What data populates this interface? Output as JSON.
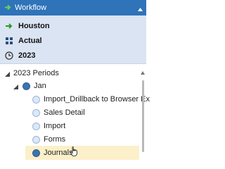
{
  "header": {
    "title": "Workflow"
  },
  "pov": [
    {
      "icon": "arrow-right-icon",
      "label": "Houston"
    },
    {
      "icon": "scenario-grid-icon",
      "label": "Actual"
    },
    {
      "icon": "clock-icon",
      "label": "2023"
    }
  ],
  "tree": {
    "root": "2023 Periods",
    "period": "Jan",
    "items": [
      "Import_Drillback to Browser Ex",
      "Sales Detail",
      "Import",
      "Forms",
      "Journals"
    ],
    "selected": "Journals"
  },
  "colors": {
    "header_bg": "#2f73b9",
    "pov_bg": "#dbe4f2",
    "selected_bg": "#fbf0c9",
    "node_filled": "#3c72b0"
  }
}
